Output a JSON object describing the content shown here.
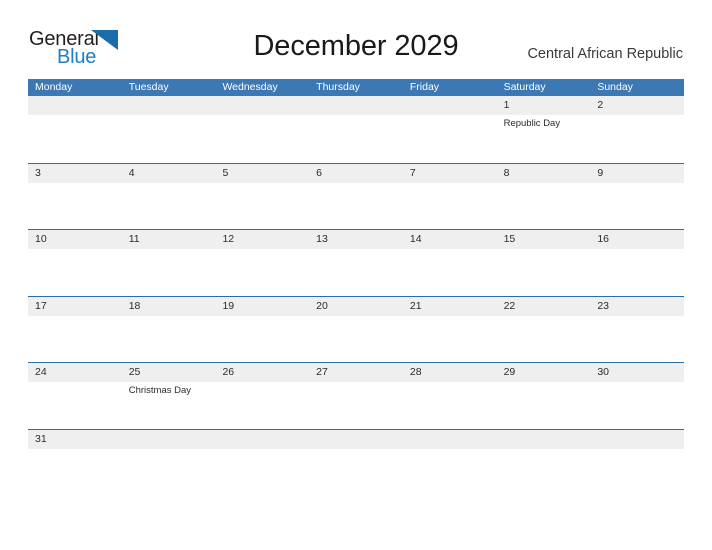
{
  "brand": {
    "logo_text_primary": "General",
    "logo_text_secondary": "Blue",
    "logo_icon": "blue-flag-triangle-icon",
    "color_primary": "#231f20",
    "color_secondary": "#1b7fc4"
  },
  "header": {
    "title": "December 2029",
    "country": "Central African Republic"
  },
  "colors": {
    "header_bar": "#3c78b4",
    "row_band": "#efefef",
    "row_rule": "#2e6da4",
    "page_background": "#ffffff",
    "text": "#2b2b2b"
  },
  "calendar": {
    "month": "December",
    "year": "2029",
    "weekday_headers": [
      "Monday",
      "Tuesday",
      "Wednesday",
      "Thursday",
      "Friday",
      "Saturday",
      "Sunday"
    ],
    "weeks": [
      [
        {
          "day": "",
          "event": ""
        },
        {
          "day": "",
          "event": ""
        },
        {
          "day": "",
          "event": ""
        },
        {
          "day": "",
          "event": ""
        },
        {
          "day": "",
          "event": ""
        },
        {
          "day": "1",
          "event": "Republic Day"
        },
        {
          "day": "2",
          "event": ""
        }
      ],
      [
        {
          "day": "3",
          "event": ""
        },
        {
          "day": "4",
          "event": ""
        },
        {
          "day": "5",
          "event": ""
        },
        {
          "day": "6",
          "event": ""
        },
        {
          "day": "7",
          "event": ""
        },
        {
          "day": "8",
          "event": ""
        },
        {
          "day": "9",
          "event": ""
        }
      ],
      [
        {
          "day": "10",
          "event": ""
        },
        {
          "day": "11",
          "event": ""
        },
        {
          "day": "12",
          "event": ""
        },
        {
          "day": "13",
          "event": ""
        },
        {
          "day": "14",
          "event": ""
        },
        {
          "day": "15",
          "event": ""
        },
        {
          "day": "16",
          "event": ""
        }
      ],
      [
        {
          "day": "17",
          "event": ""
        },
        {
          "day": "18",
          "event": ""
        },
        {
          "day": "19",
          "event": ""
        },
        {
          "day": "20",
          "event": ""
        },
        {
          "day": "21",
          "event": ""
        },
        {
          "day": "22",
          "event": ""
        },
        {
          "day": "23",
          "event": ""
        }
      ],
      [
        {
          "day": "24",
          "event": ""
        },
        {
          "day": "25",
          "event": "Christmas Day"
        },
        {
          "day": "26",
          "event": ""
        },
        {
          "day": "27",
          "event": ""
        },
        {
          "day": "28",
          "event": ""
        },
        {
          "day": "29",
          "event": ""
        },
        {
          "day": "30",
          "event": ""
        }
      ],
      [
        {
          "day": "31",
          "event": ""
        },
        {
          "day": "",
          "event": ""
        },
        {
          "day": "",
          "event": ""
        },
        {
          "day": "",
          "event": ""
        },
        {
          "day": "",
          "event": ""
        },
        {
          "day": "",
          "event": ""
        },
        {
          "day": "",
          "event": ""
        }
      ]
    ]
  }
}
